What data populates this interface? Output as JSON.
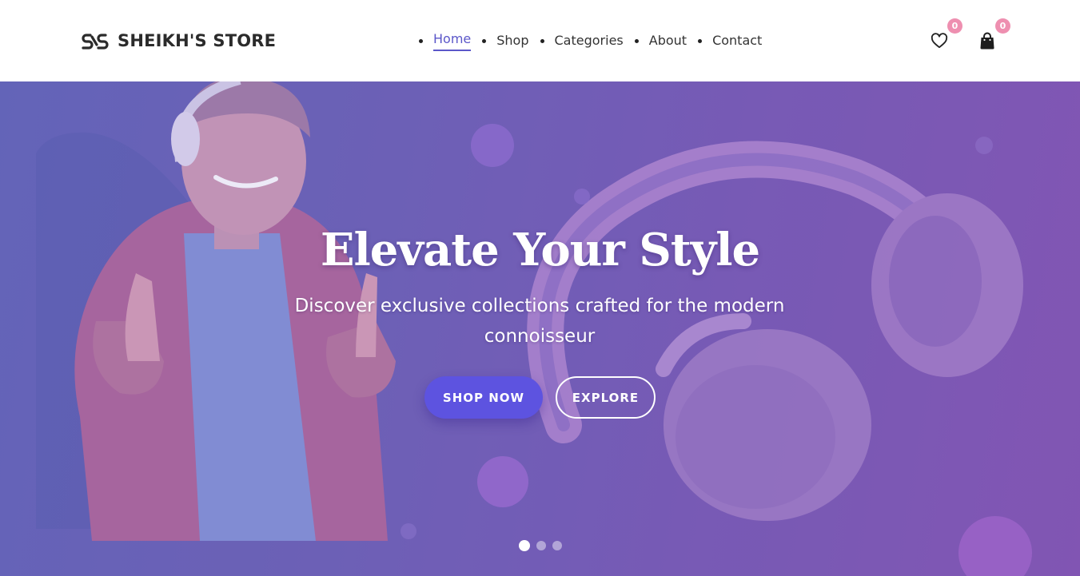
{
  "brand": {
    "name": "SHEIKH'S STORE",
    "logo_icon": "double-s-link-icon"
  },
  "nav": {
    "items": [
      {
        "label": "Home",
        "active": true
      },
      {
        "label": "Shop",
        "active": false
      },
      {
        "label": "Categories",
        "active": false
      },
      {
        "label": "About",
        "active": false
      },
      {
        "label": "Contact",
        "active": false
      }
    ]
  },
  "header_actions": {
    "wishlist": {
      "icon": "heart-icon",
      "count": "0"
    },
    "cart": {
      "icon": "shopping-bag-icon",
      "count": "0"
    }
  },
  "hero": {
    "title": "Elevate Your Style",
    "subtitle": "Discover exclusive collections crafted for the modern connoisseur",
    "primary_button": "SHOP NOW",
    "secondary_button": "EXPLORE",
    "slides_total": 3,
    "active_slide": 1
  },
  "colors": {
    "accent": "#5b57c9",
    "badge": "#ee8fb0",
    "primary_button": "#5d53e0",
    "hero_gradient_start": "#6467b8",
    "hero_gradient_end": "#8656b2"
  }
}
